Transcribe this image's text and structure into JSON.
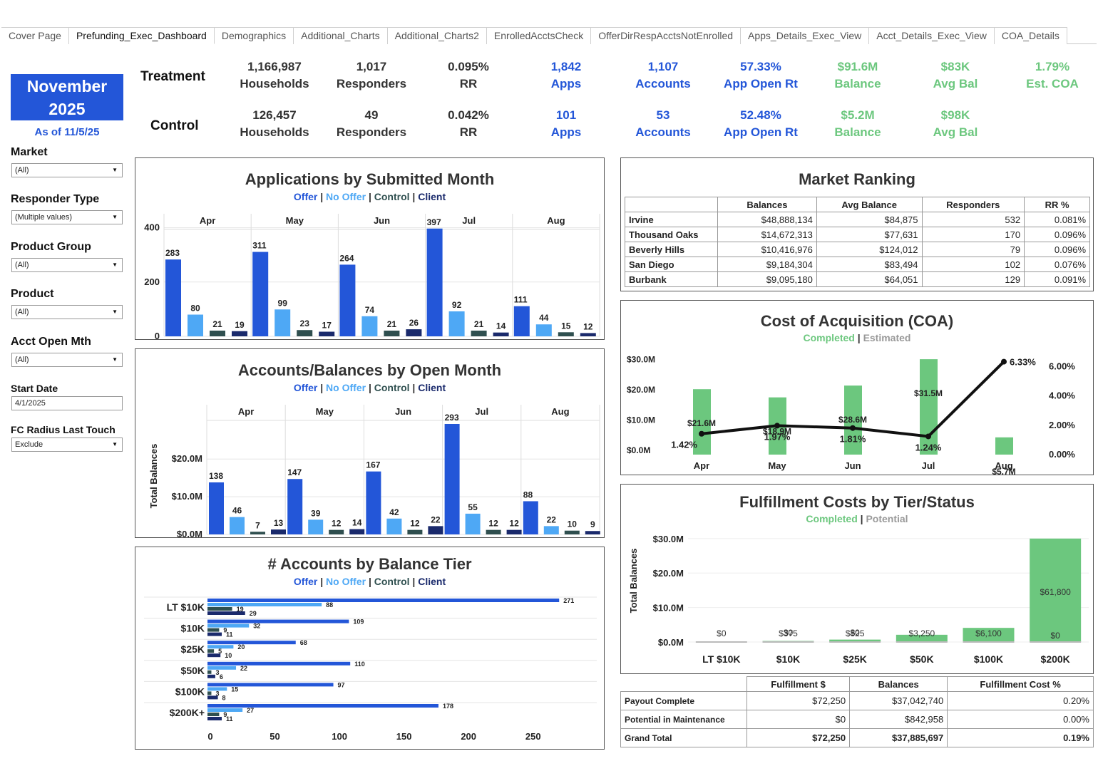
{
  "tabs": [
    "Cover Page",
    "Prefunding_Exec_Dashboard",
    "Demographics",
    "Additional_Charts",
    "Additional_Charts2",
    "EnrolledAcctsCheck",
    "OfferDirRespAcctsNotEnrolled",
    "Apps_Details_Exec_View",
    "Acct_Details_Exec_View",
    "COA_Details"
  ],
  "active_tab": 1,
  "header": {
    "month": "November",
    "year": "2025",
    "as_of": "As of 11/5/25"
  },
  "filters": {
    "market": {
      "label": "Market",
      "value": "(All)"
    },
    "responder_type": {
      "label": "Responder Type",
      "value": "(Multiple values)"
    },
    "product_group": {
      "label": "Product Group",
      "value": "(All)"
    },
    "product": {
      "label": "Product",
      "value": "(All)"
    },
    "acct_open_mth": {
      "label": "Acct Open Mth",
      "value": "(All)"
    },
    "start_date": {
      "label": "Start Date",
      "value": "4/1/2025"
    },
    "fc_radius": {
      "label": "FC Radius Last Touch",
      "value": "Exclude"
    }
  },
  "kpi": {
    "treatment_label": "Treatment",
    "control_label": "Control",
    "treatment": [
      {
        "value": "1,166,987",
        "label": "Households",
        "color": "black"
      },
      {
        "value": "1,017",
        "label": "Responders",
        "color": "black"
      },
      {
        "value": "0.095%",
        "label": "RR",
        "color": "black"
      },
      {
        "value": "1,842",
        "label": "Apps",
        "color": "blue"
      },
      {
        "value": "1,107",
        "label": "Accounts",
        "color": "blue"
      },
      {
        "value": "57.33%",
        "label": "App Open Rt",
        "color": "blue"
      },
      {
        "value": "$91.6M",
        "label": "Balance",
        "color": "green"
      },
      {
        "value": "$83K",
        "label": "Avg Bal",
        "color": "green"
      },
      {
        "value": "1.79%",
        "label": "Est. COA",
        "color": "green"
      }
    ],
    "control": [
      {
        "value": "126,457",
        "label": "Households",
        "color": "black"
      },
      {
        "value": "49",
        "label": "Responders",
        "color": "black"
      },
      {
        "value": "0.042%",
        "label": "RR",
        "color": "black"
      },
      {
        "value": "101",
        "label": "Apps",
        "color": "blue"
      },
      {
        "value": "53",
        "label": "Accounts",
        "color": "blue"
      },
      {
        "value": "52.48%",
        "label": "App Open Rt",
        "color": "blue"
      },
      {
        "value": "$5.2M",
        "label": "Balance",
        "color": "green"
      },
      {
        "value": "$98K",
        "label": "Avg Bal",
        "color": "green"
      }
    ]
  },
  "legend": {
    "offer": "Offer",
    "no_offer": "No Offer",
    "control": "Control",
    "client": "Client",
    "sep": "|",
    "completed": "Completed",
    "estimated": "Estimated",
    "potential": "Potential"
  },
  "colors": {
    "offer": "#2356d8",
    "no_offer": "#4ea8f5",
    "control": "#2f4f4f",
    "client": "#1a2a6c",
    "green": "#6cc77e",
    "line": "#111111"
  },
  "chart_data": [
    {
      "id": "apps",
      "type": "bar",
      "title": "Applications by Submitted Month",
      "categories": [
        "Apr",
        "May",
        "Jun",
        "Jul",
        "Aug"
      ],
      "series": [
        {
          "name": "Offer",
          "values": [
            283,
            311,
            264,
            397,
            111
          ]
        },
        {
          "name": "No Offer",
          "values": [
            80,
            99,
            74,
            92,
            44
          ]
        },
        {
          "name": "Control",
          "values": [
            21,
            23,
            21,
            21,
            15
          ]
        },
        {
          "name": "Client",
          "values": [
            19,
            17,
            26,
            14,
            12
          ]
        }
      ],
      "yticks": [
        "0",
        "200",
        "400"
      ],
      "ylim": [
        0,
        420
      ]
    },
    {
      "id": "accts",
      "type": "bar",
      "title": "Accounts/Balances by Open Month",
      "ylabel": "Total Balances",
      "categories": [
        "Apr",
        "May",
        "Jun",
        "Jul",
        "Aug"
      ],
      "series": [
        {
          "name": "Offer",
          "values": [
            138,
            147,
            167,
            293,
            88
          ]
        },
        {
          "name": "No Offer",
          "values": [
            46,
            39,
            42,
            55,
            22
          ]
        },
        {
          "name": "Control",
          "values": [
            7,
            12,
            12,
            12,
            10
          ]
        },
        {
          "name": "Client",
          "values": [
            13,
            14,
            22,
            12,
            9
          ]
        }
      ],
      "yticks": [
        "$0.0M",
        "$10.0M",
        "$20.0M"
      ],
      "ylim": [
        0,
        310
      ]
    },
    {
      "id": "tier",
      "type": "bar",
      "orientation": "horizontal",
      "title": "# Accounts by Balance Tier",
      "categories": [
        "LT $10K",
        "$10K",
        "$25K",
        "$50K",
        "$100K",
        "$200K+"
      ],
      "series": [
        {
          "name": "Offer",
          "values": [
            271,
            109,
            68,
            110,
            97,
            178
          ]
        },
        {
          "name": "No Offer",
          "values": [
            88,
            32,
            20,
            22,
            15,
            27
          ]
        },
        {
          "name": "Control",
          "values": [
            19,
            9,
            5,
            3,
            3,
            9
          ]
        },
        {
          "name": "Client",
          "values": [
            29,
            11,
            10,
            6,
            8,
            11
          ]
        }
      ],
      "xticks": [
        "0",
        "50",
        "100",
        "150",
        "200",
        "250"
      ],
      "xlim": [
        0,
        300
      ]
    },
    {
      "id": "coa",
      "type": "bar",
      "title": "Cost of Acquisition (COA)",
      "categories": [
        "Apr",
        "May",
        "Jun",
        "Jul",
        "Aug"
      ],
      "bars": [
        21.6,
        18.9,
        22.8,
        31.5,
        5.7
      ],
      "bar_labels": [
        "$21.6M",
        "$18.9M",
        "$28.6M",
        "$31.5M",
        "$5.7M"
      ],
      "line": [
        1.42,
        1.97,
        1.81,
        1.24,
        6.33
      ],
      "line_labels": [
        "1.42%",
        "1.97%",
        "1.81%",
        "1.24%",
        "6.33%"
      ],
      "yticks_left": [
        "$0.0M",
        "$10.0M",
        "$20.0M",
        "$30.0M"
      ],
      "yticks_right": [
        "0.00%",
        "2.00%",
        "4.00%",
        "6.00%"
      ],
      "ylim_left": [
        0,
        32
      ],
      "ylim_right": [
        0,
        6.6
      ]
    },
    {
      "id": "fulfill",
      "type": "bar",
      "title": "Fulfillment Costs by Tier/Status",
      "ylabel": "Total Balances",
      "categories": [
        "LT $10K",
        "$10K",
        "$25K",
        "$50K",
        "$100K",
        "$200K"
      ],
      "completed": [
        0,
        0.3,
        0.7,
        2.1,
        4.1,
        30.0
      ],
      "potential": [
        0,
        0,
        0,
        0,
        0,
        0
      ],
      "completed_labels": [
        "$0",
        "$375",
        "$825",
        "$3,250",
        "$6,100",
        "$61,800"
      ],
      "potential_labels": [
        "",
        "$0",
        "$0",
        "",
        "",
        "$0"
      ],
      "yticks": [
        "$0.0M",
        "$10.0M",
        "$20.0M",
        "$30.0M"
      ],
      "ylim": [
        0,
        31
      ]
    }
  ],
  "market_ranking": {
    "title": "Market Ranking",
    "columns": [
      "",
      "Balances",
      "Avg Balance",
      "Responders",
      "RR %"
    ],
    "rows": [
      [
        "Irvine",
        "$48,888,134",
        "$84,875",
        "532",
        "0.081%"
      ],
      [
        "Thousand Oaks",
        "$14,672,313",
        "$77,631",
        "170",
        "0.096%"
      ],
      [
        "Beverly Hills",
        "$10,416,976",
        "$124,012",
        "79",
        "0.096%"
      ],
      [
        "San Diego",
        "$9,184,304",
        "$83,494",
        "102",
        "0.076%"
      ],
      [
        "Burbank",
        "$9,095,180",
        "$64,051",
        "129",
        "0.091%"
      ]
    ]
  },
  "fulfillment_table": {
    "columns": [
      "",
      "Fulfillment $",
      "Balances",
      "Fulfillment Cost %"
    ],
    "rows": [
      [
        "Payout Complete",
        "$72,250",
        "$37,042,740",
        "0.20%"
      ],
      [
        "Potential in Maintenance",
        "$0",
        "$842,958",
        "0.00%"
      ],
      [
        "Grand Total",
        "$72,250",
        "$37,885,697",
        "0.19%"
      ]
    ]
  }
}
